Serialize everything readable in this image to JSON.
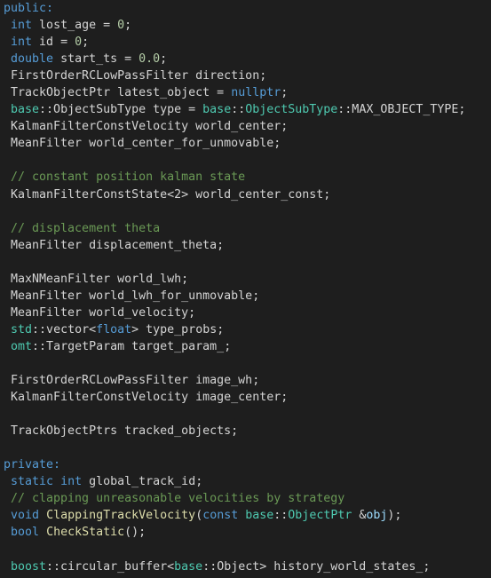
{
  "colors": {
    "background": "#1e1e1e",
    "plain": "#d4d4d4",
    "keyword": "#569cd6",
    "namespace": "#4ec9b0",
    "function": "#dcdcaa",
    "comment": "#6a9955",
    "number": "#b5cea8",
    "variable": "#9cdcfe"
  },
  "code_lines": [
    [
      {
        "t": "public:",
        "c": "acc"
      }
    ],
    [
      {
        "t": " ",
        "c": "pln"
      },
      {
        "t": "int",
        "c": "kw"
      },
      {
        "t": " lost_age = ",
        "c": "pln"
      },
      {
        "t": "0",
        "c": "num"
      },
      {
        "t": ";",
        "c": "pln"
      }
    ],
    [
      {
        "t": " ",
        "c": "pln"
      },
      {
        "t": "int",
        "c": "kw"
      },
      {
        "t": " id = ",
        "c": "pln"
      },
      {
        "t": "0",
        "c": "num"
      },
      {
        "t": ";",
        "c": "pln"
      }
    ],
    [
      {
        "t": " ",
        "c": "pln"
      },
      {
        "t": "double",
        "c": "kw"
      },
      {
        "t": " start_ts = ",
        "c": "pln"
      },
      {
        "t": "0.0",
        "c": "num"
      },
      {
        "t": ";",
        "c": "pln"
      }
    ],
    [
      {
        "t": " FirstOrderRCLowPassFilter direction;",
        "c": "pln"
      }
    ],
    [
      {
        "t": " TrackObjectPtr latest_object = ",
        "c": "pln"
      },
      {
        "t": "nullptr",
        "c": "kw"
      },
      {
        "t": ";",
        "c": "pln"
      }
    ],
    [
      {
        "t": " ",
        "c": "pln"
      },
      {
        "t": "base",
        "c": "ns"
      },
      {
        "t": "::ObjectSubType type = ",
        "c": "pln"
      },
      {
        "t": "base",
        "c": "ns"
      },
      {
        "t": "::",
        "c": "pln"
      },
      {
        "t": "ObjectSubType",
        "c": "type"
      },
      {
        "t": "::MAX_OBJECT_TYPE;",
        "c": "pln"
      }
    ],
    [
      {
        "t": " KalmanFilterConstVelocity world_center;",
        "c": "pln"
      }
    ],
    [
      {
        "t": " MeanFilter world_center_for_unmovable;",
        "c": "pln"
      }
    ],
    [],
    [
      {
        "t": " // constant position kalman state",
        "c": "com"
      }
    ],
    [
      {
        "t": " KalmanFilterConstState<2> world_center_const;",
        "c": "pln"
      }
    ],
    [],
    [
      {
        "t": " // displacement theta",
        "c": "com"
      }
    ],
    [
      {
        "t": " MeanFilter displacement_theta;",
        "c": "pln"
      }
    ],
    [],
    [
      {
        "t": " MaxNMeanFilter world_lwh;",
        "c": "pln"
      }
    ],
    [
      {
        "t": " MeanFilter world_lwh_for_unmovable;",
        "c": "pln"
      }
    ],
    [
      {
        "t": " MeanFilter world_velocity;",
        "c": "pln"
      }
    ],
    [
      {
        "t": " ",
        "c": "pln"
      },
      {
        "t": "std",
        "c": "ns"
      },
      {
        "t": "::vector<",
        "c": "pln"
      },
      {
        "t": "float",
        "c": "kw"
      },
      {
        "t": "> type_probs;",
        "c": "pln"
      }
    ],
    [
      {
        "t": " ",
        "c": "pln"
      },
      {
        "t": "omt",
        "c": "ns"
      },
      {
        "t": "::TargetParam target_param_;",
        "c": "pln"
      }
    ],
    [],
    [
      {
        "t": " FirstOrderRCLowPassFilter image_wh;",
        "c": "pln"
      }
    ],
    [
      {
        "t": " KalmanFilterConstVelocity image_center;",
        "c": "pln"
      }
    ],
    [],
    [
      {
        "t": " TrackObjectPtrs tracked_objects;",
        "c": "pln"
      }
    ],
    [],
    [
      {
        "t": "private:",
        "c": "acc"
      }
    ],
    [
      {
        "t": " ",
        "c": "pln"
      },
      {
        "t": "static",
        "c": "kw"
      },
      {
        "t": " ",
        "c": "pln"
      },
      {
        "t": "int",
        "c": "kw"
      },
      {
        "t": " global_track_id;",
        "c": "pln"
      }
    ],
    [
      {
        "t": " // clapping unreasonable velocities by strategy",
        "c": "com"
      }
    ],
    [
      {
        "t": " ",
        "c": "pln"
      },
      {
        "t": "void",
        "c": "kw"
      },
      {
        "t": " ",
        "c": "pln"
      },
      {
        "t": "ClappingTrackVelocity",
        "c": "fn"
      },
      {
        "t": "(",
        "c": "pln"
      },
      {
        "t": "const",
        "c": "kw"
      },
      {
        "t": " ",
        "c": "pln"
      },
      {
        "t": "base",
        "c": "ns"
      },
      {
        "t": "::",
        "c": "pln"
      },
      {
        "t": "ObjectPtr",
        "c": "type"
      },
      {
        "t": " &",
        "c": "pln"
      },
      {
        "t": "obj",
        "c": "var"
      },
      {
        "t": ");",
        "c": "pln"
      }
    ],
    [
      {
        "t": " ",
        "c": "pln"
      },
      {
        "t": "bool",
        "c": "kw"
      },
      {
        "t": " ",
        "c": "pln"
      },
      {
        "t": "CheckStatic",
        "c": "fn"
      },
      {
        "t": "();",
        "c": "pln"
      }
    ],
    [],
    [
      {
        "t": " ",
        "c": "pln"
      },
      {
        "t": "boost",
        "c": "ns"
      },
      {
        "t": "::circular_buffer<",
        "c": "pln"
      },
      {
        "t": "base",
        "c": "ns"
      },
      {
        "t": "::Object> history_world_states_;",
        "c": "pln"
      }
    ]
  ]
}
